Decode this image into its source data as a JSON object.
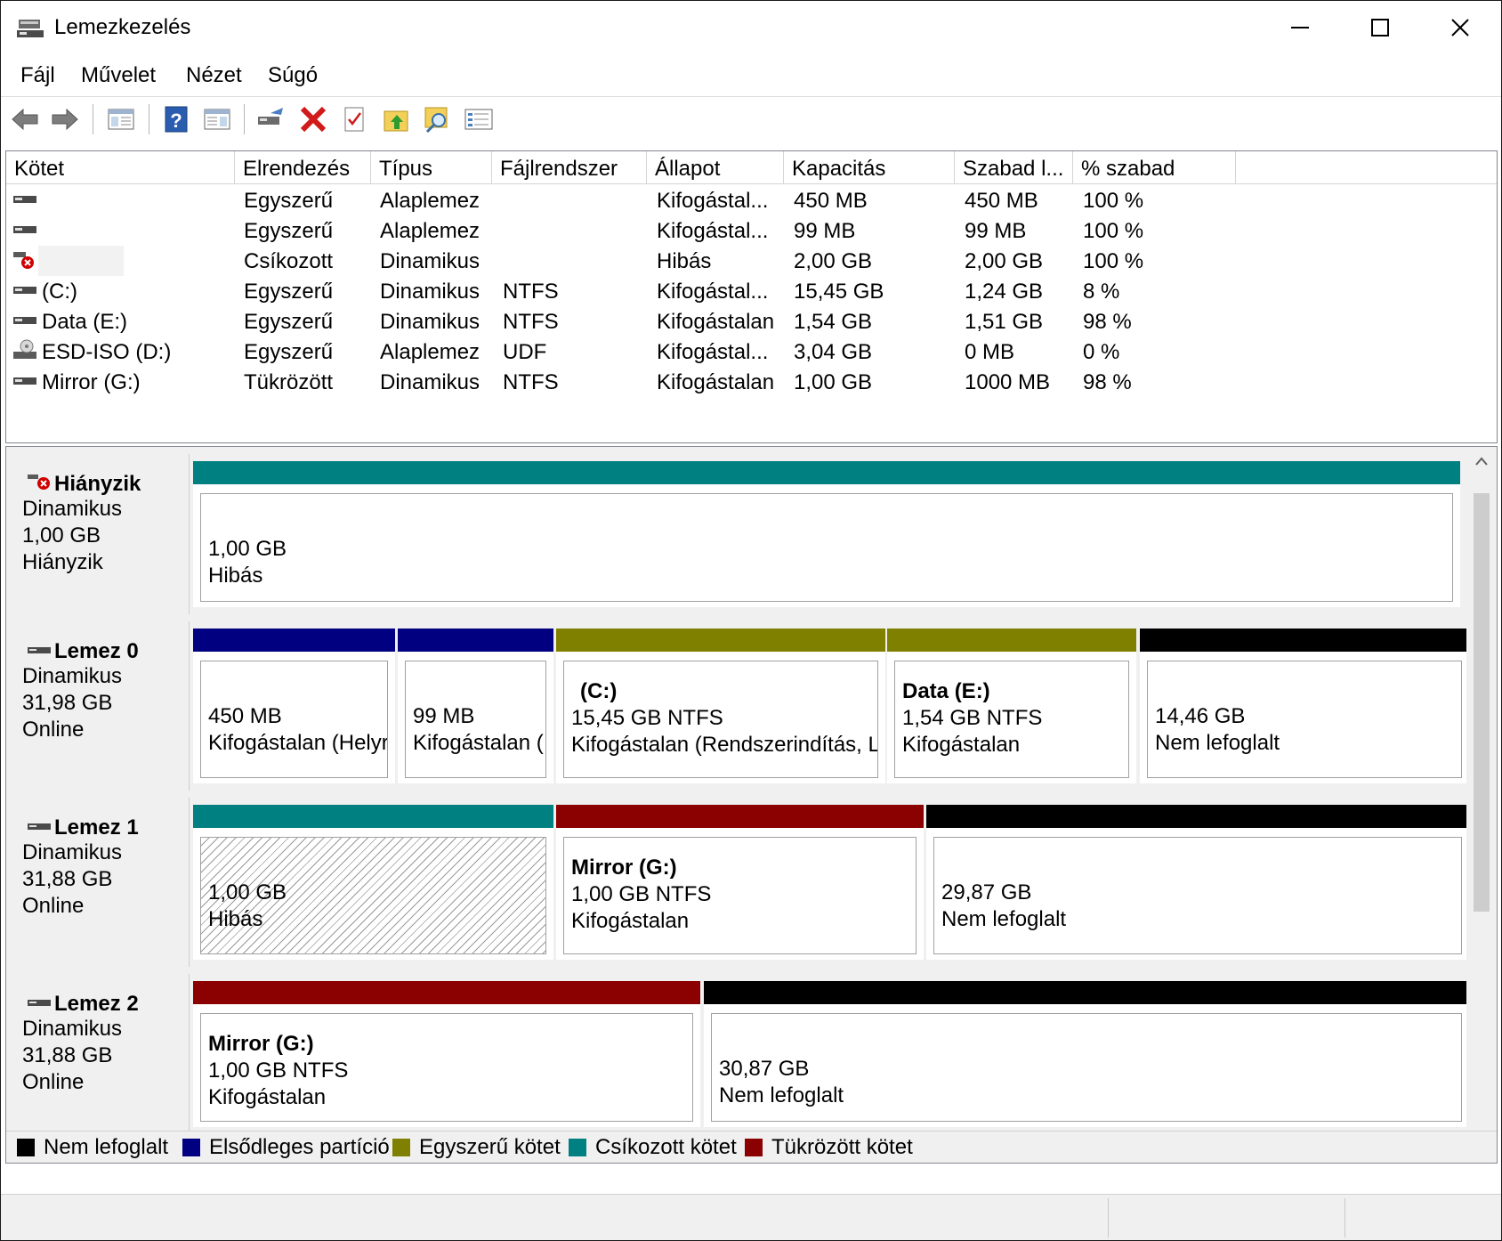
{
  "window": {
    "title": "Lemezkezelés"
  },
  "menu": [
    "Fájl",
    "Művelet",
    "Nézet",
    "Súgó"
  ],
  "toolbar": {
    "icons": [
      "back-icon",
      "forward-icon",
      "console-tree-icon",
      "help-icon",
      "action-pane-icon",
      "connect-disk-icon",
      "delete-icon",
      "checklist-icon",
      "folder-up-icon",
      "search-folder-icon",
      "properties-icon"
    ]
  },
  "volume_list": {
    "columns": [
      "Kötet",
      "Elrendezés",
      "Típus",
      "Fájlrendszer",
      "Állapot",
      "Kapacitás",
      "Szabad l...",
      "% szabad"
    ],
    "rows": [
      {
        "volume": "",
        "layout": "Egyszerű",
        "type": "Alaplemez",
        "fs": "",
        "status": "Kifogástal...",
        "capacity": "450 MB",
        "free": "450 MB",
        "pct": "100 %",
        "icon": "drive-icon"
      },
      {
        "volume": "",
        "layout": "Egyszerű",
        "type": "Alaplemez",
        "fs": "",
        "status": "Kifogástal...",
        "capacity": "99 MB",
        "free": "99 MB",
        "pct": "100 %",
        "icon": "drive-icon"
      },
      {
        "volume": "",
        "layout": "Csíkozott",
        "type": "Dinamikus",
        "fs": "",
        "status": "Hibás",
        "capacity": "2,00 GB",
        "free": "2,00 GB",
        "pct": "100 %",
        "icon": "drive-error-icon"
      },
      {
        "volume": "(C:)",
        "layout": "Egyszerű",
        "type": "Dinamikus",
        "fs": "NTFS",
        "status": "Kifogástal...",
        "capacity": "15,45 GB",
        "free": "1,24 GB",
        "pct": "8 %",
        "icon": "drive-icon"
      },
      {
        "volume": "Data (E:)",
        "layout": "Egyszerű",
        "type": "Dinamikus",
        "fs": "NTFS",
        "status": "Kifogástalan",
        "capacity": "1,54 GB",
        "free": "1,51 GB",
        "pct": "98 %",
        "icon": "drive-icon"
      },
      {
        "volume": "ESD-ISO (D:)",
        "layout": "Egyszerű",
        "type": "Alaplemez",
        "fs": "UDF",
        "status": "Kifogástal...",
        "capacity": "3,04 GB",
        "free": "0 MB",
        "pct": "0 %",
        "icon": "cd-drive-icon"
      },
      {
        "volume": "Mirror (G:)",
        "layout": "Tükrözött",
        "type": "Dinamikus",
        "fs": "NTFS",
        "status": "Kifogástalan",
        "capacity": "1,00 GB",
        "free": "1000 MB",
        "pct": "98 %",
        "icon": "drive-icon"
      }
    ]
  },
  "disks": [
    {
      "name": "Hiányzik",
      "kind": "Dinamikus",
      "size": "1,00 GB",
      "state": "Hiányzik",
      "icon": "disk-missing-icon",
      "partitions": [
        {
          "bar": "#008080",
          "lines": [
            "1,00 GB",
            "Hibás"
          ],
          "bold_first": false
        }
      ]
    },
    {
      "name": "Lemez 0",
      "kind": "Dinamikus",
      "size": "31,98 GB",
      "state": "Online",
      "icon": "disk-icon",
      "partitions": [
        {
          "bar": "#000080",
          "lines": [
            "450 MB",
            "Kifogástalan (Helyr"
          ],
          "bold_first": false
        },
        {
          "bar": "#000080",
          "lines": [
            "99 MB",
            "Kifogástalan ("
          ],
          "bold_first": false
        },
        {
          "bar": "#808000",
          "lines": [
            "(C:)",
            "15,45 GB NTFS",
            "Kifogástalan (Rendszerindítás, La"
          ],
          "bold_first": true
        },
        {
          "bar": "#808000",
          "lines": [
            "Data  (E:)",
            "1,54 GB NTFS",
            "Kifogástalan"
          ],
          "bold_first": true
        },
        {
          "bar": "#000000",
          "lines": [
            "14,46 GB",
            "Nem lefoglalt"
          ],
          "bold_first": false
        }
      ]
    },
    {
      "name": "Lemez 1",
      "kind": "Dinamikus",
      "size": "31,88 GB",
      "state": "Online",
      "icon": "disk-icon",
      "partitions": [
        {
          "bar": "#008080",
          "lines": [
            "1,00 GB",
            "Hibás"
          ],
          "bold_first": false,
          "hatched": true
        },
        {
          "bar": "#8b0000",
          "lines": [
            "Mirror  (G:)",
            "1,00 GB NTFS",
            "Kifogástalan"
          ],
          "bold_first": true
        },
        {
          "bar": "#000000",
          "lines": [
            "29,87 GB",
            "Nem lefoglalt"
          ],
          "bold_first": false
        }
      ]
    },
    {
      "name": "Lemez 2",
      "kind": "Dinamikus",
      "size": "31,88 GB",
      "state": "Online",
      "icon": "disk-icon",
      "partitions": [
        {
          "bar": "#8b0000",
          "lines": [
            "Mirror  (G:)",
            "1,00 GB NTFS",
            "Kifogástalan"
          ],
          "bold_first": true
        },
        {
          "bar": "#000000",
          "lines": [
            "30,87 GB",
            "Nem lefoglalt"
          ],
          "bold_first": false
        }
      ]
    }
  ],
  "legend": [
    {
      "label": "Nem lefoglalt",
      "color": "#000000"
    },
    {
      "label": "Elsődleges partíció",
      "color": "#000080"
    },
    {
      "label": "Egyszerű kötet",
      "color": "#808000"
    },
    {
      "label": "Csíkozott kötet",
      "color": "#008080"
    },
    {
      "label": "Tükrözött kötet",
      "color": "#8b0000"
    }
  ]
}
